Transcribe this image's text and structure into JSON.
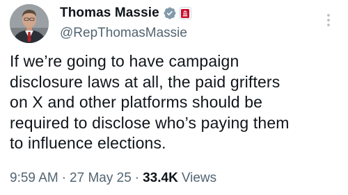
{
  "author": {
    "name": "Thomas Massie",
    "handle": "@RepThomasMassie",
    "verified_color": "#829aab",
    "affiliate_color": "#c8102e"
  },
  "tweet": {
    "text": "If we’re going to have campaign\ndisclosure laws at all, the paid grifters\non X and other platforms should be\nrequired to disclose who’s paying them\nto influence elections."
  },
  "meta": {
    "time": "9:59 AM",
    "separator": "·",
    "date": "27 May 25",
    "views_count": "33.4K",
    "views_label": "Views"
  },
  "icons": {
    "more": "more-vertical-icon",
    "verified": "verified-badge-icon",
    "affiliate": "us-house-seal-icon"
  },
  "colors": {
    "text_primary": "#0f1419",
    "text_secondary": "#536471",
    "background": "#ffffff"
  }
}
